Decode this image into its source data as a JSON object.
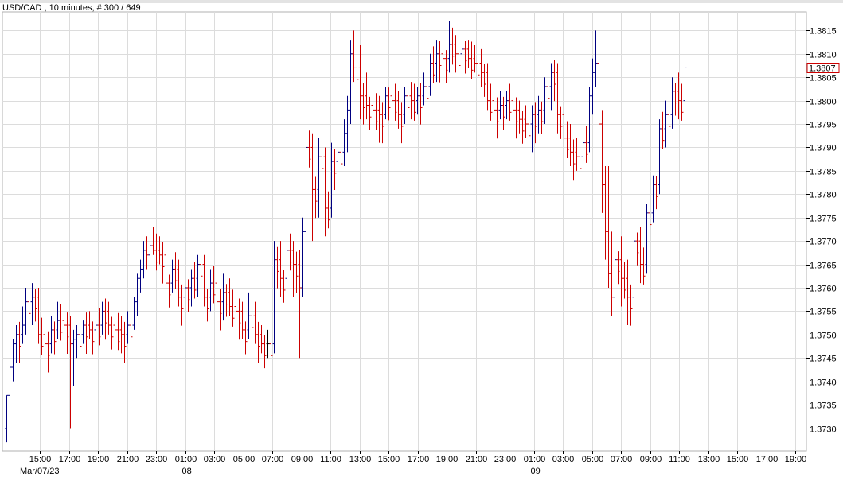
{
  "chart_data": {
    "type": "bar",
    "style": "ohlc",
    "title": "USD/CAD , 10 minutes, # 300 / 649",
    "symbol": "USD/CAD",
    "timeframe": "10 minutes",
    "current_price": "1.3807",
    "y_ticks": [
      "1.3730",
      "1.3735",
      "1.3740",
      "1.3745",
      "1.3750",
      "1.3755",
      "1.3760",
      "1.3765",
      "1.3770",
      "1.3775",
      "1.3780",
      "1.3785",
      "1.3790",
      "1.3795",
      "1.3800",
      "1.3805",
      "1.3810",
      "1.3815"
    ],
    "x_ticks": [
      "15:00",
      "17:00",
      "19:00",
      "21:00",
      "23:00",
      "01:00",
      "03:00",
      "05:00",
      "07:00",
      "09:00",
      "11:00",
      "13:00",
      "15:00",
      "17:00",
      "19:00",
      "21:00",
      "23:00",
      "01:00",
      "03:00",
      "05:00",
      "07:00",
      "09:00",
      "11:00",
      "13:00",
      "15:00",
      "17:00",
      "19:00"
    ],
    "date_labels": [
      {
        "text": "Mar/07/23",
        "at_tick": 0
      },
      {
        "text": "08",
        "at_tick": 5
      },
      {
        "text": "09",
        "at_tick": 17
      }
    ],
    "ylim": [
      1.3725,
      1.382
    ],
    "grid": true,
    "colors": {
      "up": "#000080",
      "down": "#cc0000",
      "neutral": "#000000",
      "price_line": "#000080",
      "price_box": "#cc0000",
      "grid": "#dcdcdc"
    },
    "series": [
      {
        "anchors": [
          [
            0,
            1.373,
            1.3737,
            1.3727,
            1.3737
          ],
          [
            1,
            1.3737,
            1.3746,
            1.3729,
            1.3743
          ],
          [
            2,
            1.3743,
            1.3749,
            1.374,
            1.3748
          ],
          [
            3,
            1.3748,
            1.3752,
            1.3744,
            1.375
          ],
          [
            5,
            1.375,
            1.3756,
            1.3748,
            1.3752
          ],
          [
            6,
            1.3752,
            1.376,
            1.375,
            1.3757
          ],
          [
            8,
            1.3757,
            1.3761,
            1.3752,
            1.3758
          ],
          [
            10,
            1.3758,
            1.376,
            1.3748,
            1.375
          ],
          [
            12,
            1.375,
            1.3752,
            1.3744,
            1.3748
          ],
          [
            14,
            1.3748,
            1.3754,
            1.3746,
            1.3751
          ],
          [
            16,
            1.3751,
            1.3757,
            1.3749,
            1.3753
          ],
          [
            18,
            1.3753,
            1.3756,
            1.3749,
            1.3752
          ],
          [
            20,
            1.3752,
            1.3754,
            1.373,
            1.3748
          ],
          [
            21,
            1.3748,
            1.3751,
            1.3739,
            1.3749
          ],
          [
            22,
            1.3749,
            1.3752,
            1.3745,
            1.375
          ],
          [
            24,
            1.375,
            1.3753,
            1.3748,
            1.3752
          ],
          [
            26,
            1.3752,
            1.3755,
            1.3749,
            1.3751
          ],
          [
            28,
            1.3751,
            1.3754,
            1.3749,
            1.3752
          ],
          [
            30,
            1.3752,
            1.3757,
            1.375,
            1.3755
          ],
          [
            32,
            1.3755,
            1.3757,
            1.375,
            1.3752
          ],
          [
            34,
            1.3752,
            1.3756,
            1.3749,
            1.3751
          ],
          [
            36,
            1.3751,
            1.3754,
            1.3746,
            1.375
          ],
          [
            38,
            1.375,
            1.3755,
            1.3748,
            1.3752
          ],
          [
            40,
            1.3752,
            1.3758,
            1.3751,
            1.3757
          ],
          [
            41,
            1.3757,
            1.3763,
            1.3754,
            1.3762
          ],
          [
            42,
            1.3762,
            1.3766,
            1.3759,
            1.3764
          ],
          [
            43,
            1.3764,
            1.377,
            1.3762,
            1.3768
          ],
          [
            44,
            1.3768,
            1.3771,
            1.3764,
            1.3767
          ],
          [
            45,
            1.3767,
            1.3772,
            1.3765,
            1.3769
          ],
          [
            46,
            1.3769,
            1.3773,
            1.3767,
            1.3768
          ],
          [
            48,
            1.3768,
            1.3771,
            1.3765,
            1.3767
          ],
          [
            50,
            1.3767,
            1.3769,
            1.3759,
            1.3761
          ],
          [
            52,
            1.3761,
            1.3766,
            1.3759,
            1.3764
          ],
          [
            54,
            1.3764,
            1.3766,
            1.3756,
            1.3758
          ],
          [
            56,
            1.3758,
            1.3762,
            1.3756,
            1.376
          ],
          [
            58,
            1.376,
            1.3764,
            1.3756,
            1.3762
          ],
          [
            60,
            1.3762,
            1.3767,
            1.3758,
            1.3765
          ],
          [
            62,
            1.3765,
            1.3767,
            1.3756,
            1.3758
          ],
          [
            64,
            1.3758,
            1.3764,
            1.3755,
            1.3761
          ],
          [
            66,
            1.3761,
            1.3764,
            1.3754,
            1.3757
          ],
          [
            68,
            1.3757,
            1.3763,
            1.3753,
            1.3759
          ],
          [
            70,
            1.3759,
            1.3762,
            1.3754,
            1.3756
          ],
          [
            72,
            1.3756,
            1.376,
            1.3753,
            1.3755
          ],
          [
            74,
            1.3755,
            1.3757,
            1.3749,
            1.3751
          ],
          [
            76,
            1.3751,
            1.3759,
            1.3749,
            1.3754
          ],
          [
            78,
            1.3754,
            1.3757,
            1.3748,
            1.375
          ],
          [
            80,
            1.375,
            1.3752,
            1.3746,
            1.3748
          ],
          [
            82,
            1.3748,
            1.3751,
            1.3745,
            1.3748
          ],
          [
            84,
            1.3748,
            1.377,
            1.3746,
            1.3766
          ],
          [
            86,
            1.3766,
            1.377,
            1.3758,
            1.3762
          ],
          [
            88,
            1.3762,
            1.3772,
            1.3759,
            1.3768
          ],
          [
            90,
            1.3768,
            1.377,
            1.3758,
            1.3765
          ],
          [
            92,
            1.3765,
            1.3768,
            1.3745,
            1.376
          ],
          [
            93,
            1.376,
            1.3775,
            1.3758,
            1.3772
          ],
          [
            94,
            1.3772,
            1.3793,
            1.3762,
            1.379
          ],
          [
            96,
            1.379,
            1.3793,
            1.377,
            1.3781
          ],
          [
            98,
            1.3781,
            1.3792,
            1.3775,
            1.3788
          ],
          [
            100,
            1.3788,
            1.379,
            1.3771,
            1.3777
          ],
          [
            102,
            1.3777,
            1.3791,
            1.3775,
            1.3787
          ],
          [
            104,
            1.3787,
            1.3792,
            1.3783,
            1.3789
          ],
          [
            106,
            1.3789,
            1.3796,
            1.3786,
            1.3793
          ],
          [
            107,
            1.3793,
            1.3801,
            1.3789,
            1.3798
          ],
          [
            108,
            1.3798,
            1.3813,
            1.3795,
            1.381
          ],
          [
            109,
            1.381,
            1.3815,
            1.3804,
            1.3807
          ],
          [
            111,
            1.3807,
            1.3812,
            1.3796,
            1.3801
          ],
          [
            113,
            1.3801,
            1.3806,
            1.3796,
            1.3799
          ],
          [
            115,
            1.3799,
            1.3802,
            1.3792,
            1.3798
          ],
          [
            117,
            1.3798,
            1.3801,
            1.3791,
            1.3797
          ],
          [
            119,
            1.3797,
            1.3803,
            1.3796,
            1.3801
          ],
          [
            121,
            1.3801,
            1.3806,
            1.3783,
            1.38
          ],
          [
            123,
            1.38,
            1.3802,
            1.3794,
            1.3797
          ],
          [
            125,
            1.3797,
            1.3803,
            1.3795,
            1.3801
          ],
          [
            127,
            1.3801,
            1.3804,
            1.3796,
            1.38
          ],
          [
            129,
            1.38,
            1.3803,
            1.3797,
            1.3801
          ],
          [
            131,
            1.3801,
            1.3806,
            1.3799,
            1.3803
          ],
          [
            133,
            1.3803,
            1.381,
            1.3801,
            1.3808
          ],
          [
            135,
            1.3808,
            1.3813,
            1.3804,
            1.381
          ],
          [
            137,
            1.381,
            1.3812,
            1.3806,
            1.3809
          ],
          [
            139,
            1.3809,
            1.3817,
            1.3806,
            1.3812
          ],
          [
            141,
            1.3812,
            1.3814,
            1.3806,
            1.381
          ],
          [
            143,
            1.381,
            1.3813,
            1.3807,
            1.3811
          ],
          [
            145,
            1.3811,
            1.3813,
            1.3807,
            1.3809
          ],
          [
            147,
            1.3809,
            1.3812,
            1.3806,
            1.3808
          ],
          [
            149,
            1.3808,
            1.3811,
            1.3803,
            1.3806
          ],
          [
            151,
            1.3806,
            1.3808,
            1.3798,
            1.38
          ],
          [
            153,
            1.38,
            1.3802,
            1.3794,
            1.3798
          ],
          [
            155,
            1.3798,
            1.3802,
            1.3796,
            1.3799
          ],
          [
            157,
            1.3799,
            1.3802,
            1.3796,
            1.38
          ],
          [
            159,
            1.38,
            1.3802,
            1.3795,
            1.3798
          ],
          [
            161,
            1.3798,
            1.38,
            1.3793,
            1.3796
          ],
          [
            163,
            1.3796,
            1.3799,
            1.3792,
            1.3795
          ],
          [
            165,
            1.3795,
            1.3799,
            1.3789,
            1.3797
          ],
          [
            167,
            1.3797,
            1.3801,
            1.3793,
            1.3798
          ],
          [
            169,
            1.3798,
            1.3805,
            1.3795,
            1.3803
          ],
          [
            171,
            1.3803,
            1.3808,
            1.3798,
            1.3806
          ],
          [
            173,
            1.3806,
            1.3808,
            1.3793,
            1.3797
          ],
          [
            175,
            1.3797,
            1.3799,
            1.3788,
            1.3792
          ],
          [
            177,
            1.3792,
            1.3795,
            1.3786,
            1.3789
          ],
          [
            179,
            1.3789,
            1.3792,
            1.3785,
            1.3788
          ],
          [
            181,
            1.3788,
            1.3794,
            1.3786,
            1.3791
          ],
          [
            183,
            1.3791,
            1.3803,
            1.3789,
            1.3801
          ],
          [
            184,
            1.3801,
            1.3809,
            1.3797,
            1.3806
          ],
          [
            185,
            1.3806,
            1.3815,
            1.3803,
            1.3808
          ],
          [
            186,
            1.3808,
            1.381,
            1.3785,
            1.3795
          ],
          [
            187,
            1.3795,
            1.3798,
            1.3776,
            1.3782
          ],
          [
            188,
            1.3782,
            1.3786,
            1.3766,
            1.3772
          ],
          [
            189,
            1.3772,
            1.3786,
            1.376,
            1.3763
          ],
          [
            190,
            1.3763,
            1.3772,
            1.3754,
            1.3758
          ],
          [
            191,
            1.3758,
            1.3771,
            1.3754,
            1.3766
          ],
          [
            193,
            1.3766,
            1.3771,
            1.3756,
            1.3762
          ],
          [
            195,
            1.3762,
            1.3766,
            1.3752,
            1.3758
          ],
          [
            197,
            1.3758,
            1.3773,
            1.3756,
            1.377
          ],
          [
            199,
            1.377,
            1.3773,
            1.3761,
            1.3765
          ],
          [
            201,
            1.3765,
            1.3778,
            1.3763,
            1.3776
          ],
          [
            203,
            1.3776,
            1.3784,
            1.3774,
            1.3782
          ],
          [
            205,
            1.3782,
            1.3796,
            1.378,
            1.3794
          ],
          [
            207,
            1.3794,
            1.38,
            1.379,
            1.3797
          ],
          [
            209,
            1.3797,
            1.3805,
            1.3794,
            1.3802
          ],
          [
            211,
            1.3802,
            1.3806,
            1.3796,
            1.38
          ],
          [
            213,
            1.38,
            1.3812,
            1.3799,
            1.3807
          ]
        ]
      }
    ]
  }
}
